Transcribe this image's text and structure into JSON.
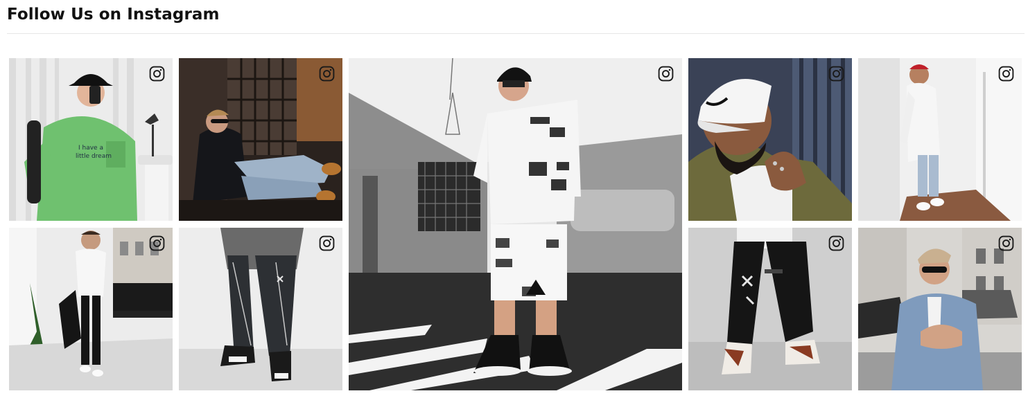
{
  "section": {
    "title": "Follow Us on Instagram"
  },
  "icons": {
    "overlay": "instagram-icon"
  },
  "colors": {
    "text": "#111111",
    "divider": "#e6e6e6",
    "icon": "#1a1a1a"
  },
  "feed": {
    "posts": [
      {
        "subject": "man in green tee taking mirror selfie"
      },
      {
        "subject": "man in sunglasses seated in ripped jeans"
      },
      {
        "subject": "man in white printed tee and shorts on crosswalk"
      },
      {
        "subject": "bearded man in white cap"
      },
      {
        "subject": "man in white jacket and cap by wall"
      },
      {
        "subject": "man in white tee walking on street"
      },
      {
        "subject": "black cargo pants and sneakers"
      },
      {
        "subject": "black joggers with sneakers"
      },
      {
        "subject": "man in denim jacket and sunglasses"
      }
    ]
  }
}
